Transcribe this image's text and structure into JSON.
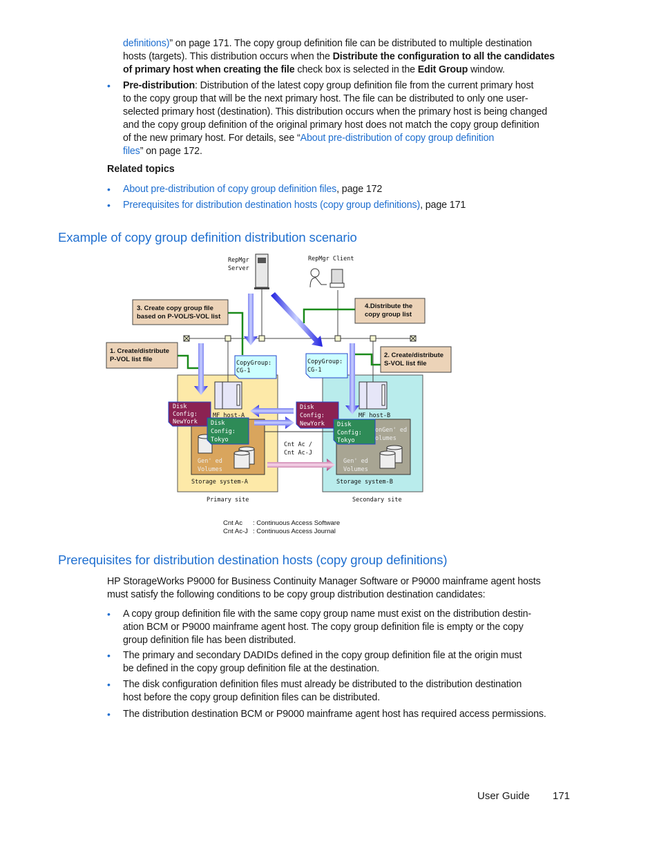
{
  "intro": {
    "link1": "definitions)",
    "t1": "” on page 171. The copy group definition file can be distributed to multiple destination",
    "t2": "hosts (targets). This distribution occurs when the ",
    "b1": "Distribute the configuration to all the candidates",
    "b2": "of primary host when creating the file",
    "t3": " check box is selected in the ",
    "b3": "Edit Group",
    "t4": " window."
  },
  "predist": {
    "term": "Pre-distribution",
    "l1": ": Distribution of the latest copy group definition file from the current primary host",
    "l2": "to the copy group that will be the next primary host. The file can be distributed to only one user-",
    "l3": "selected primary host (destination). This distribution occurs when the primary host is being changed",
    "l4": "and the copy group definition of the original primary host does not match the copy group definition",
    "l5": "of the new primary host. For details, see “",
    "link_a": "About pre-distribution of copy group definition",
    "link_b": "files",
    "l6": "” on page 172."
  },
  "related": {
    "title": "Related topics",
    "items": [
      {
        "link": "About pre-distribution of copy group definition files",
        "page": ", page 172"
      },
      {
        "link": "Prerequisites for distribution destination hosts (copy group definitions)",
        "page": ", page 171"
      }
    ]
  },
  "section1": {
    "title": "Example of copy group definition distribution scenario"
  },
  "diagram": {
    "server_l1": "RepMgr",
    "server_l2": "Server",
    "client": "RepMgr Client",
    "step3_l1": "3. Create copy group file",
    "step3_l2": "based on P-VOL/S-VOL list",
    "step4_l1": "4.Distribute the",
    "step4_l2": "copy group list",
    "step1_l1": "1. Create/distribute",
    "step1_l2": "P-VOL list file",
    "step2_l1": "2. Create/distribute",
    "step2_l2": "S-VOL list file",
    "cg_l1": "CopyGroup:",
    "cg_l2": "CG-1",
    "disk_l1": "Disk",
    "disk_l2": "Config:",
    "ny": "NewYork",
    "tokyo": "Tokyo",
    "host_a": "MF host-A",
    "host_b": "MF host-B",
    "cnt_l1": "Cnt Ac /",
    "cnt_l2": "Cnt Ac-J",
    "gen_l1": "Gen' ed",
    "gen_l2": "Volumes",
    "nongen_l1": "onGen' ed",
    "nongen_l2": "olumes",
    "storage_a": "Storage system-A",
    "storage_b": "Storage system-B",
    "primary": "Primary site",
    "secondary": "Secondary site",
    "legend": [
      {
        "abbr": "Cnt Ac",
        "desc": ": Continuous Access Software"
      },
      {
        "abbr": "Cnt Ac-J",
        "desc": ": Continuous Access Journal"
      }
    ],
    "colors": {
      "primary_site": "#fde9a8",
      "secondary_site": "#b9ecec",
      "disk_ny": "#8b2252",
      "disk_tokyo": "#2e8b57",
      "step_box": "#ecd3b8"
    }
  },
  "section2": {
    "title": "Prerequisites for distribution destination hosts (copy group definitions)",
    "intro_l1": "HP StorageWorks P9000 for Business Continuity Manager Software or P9000 mainframe agent hosts",
    "intro_l2": "must satisfy the following conditions to be copy group distribution destination candidates:",
    "bullets": [
      [
        "A copy group definition file with the same copy group name must exist on the distribution destin-",
        "ation BCM or P9000 mainframe agent host. The copy group definition file is empty or the copy",
        "group definition file has been distributed."
      ],
      [
        "The primary and secondary DADIDs defined in the copy group definition file at the origin must",
        "be defined in the copy group definition file at the destination."
      ],
      [
        "The disk configuration definition files must already be distributed to the distribution destination",
        "host before the copy group definition files can be distributed."
      ],
      [
        "The distribution destination BCM or P9000 mainframe agent host has required access permissions."
      ]
    ]
  },
  "footer": {
    "label": "User Guide",
    "page": "171"
  }
}
